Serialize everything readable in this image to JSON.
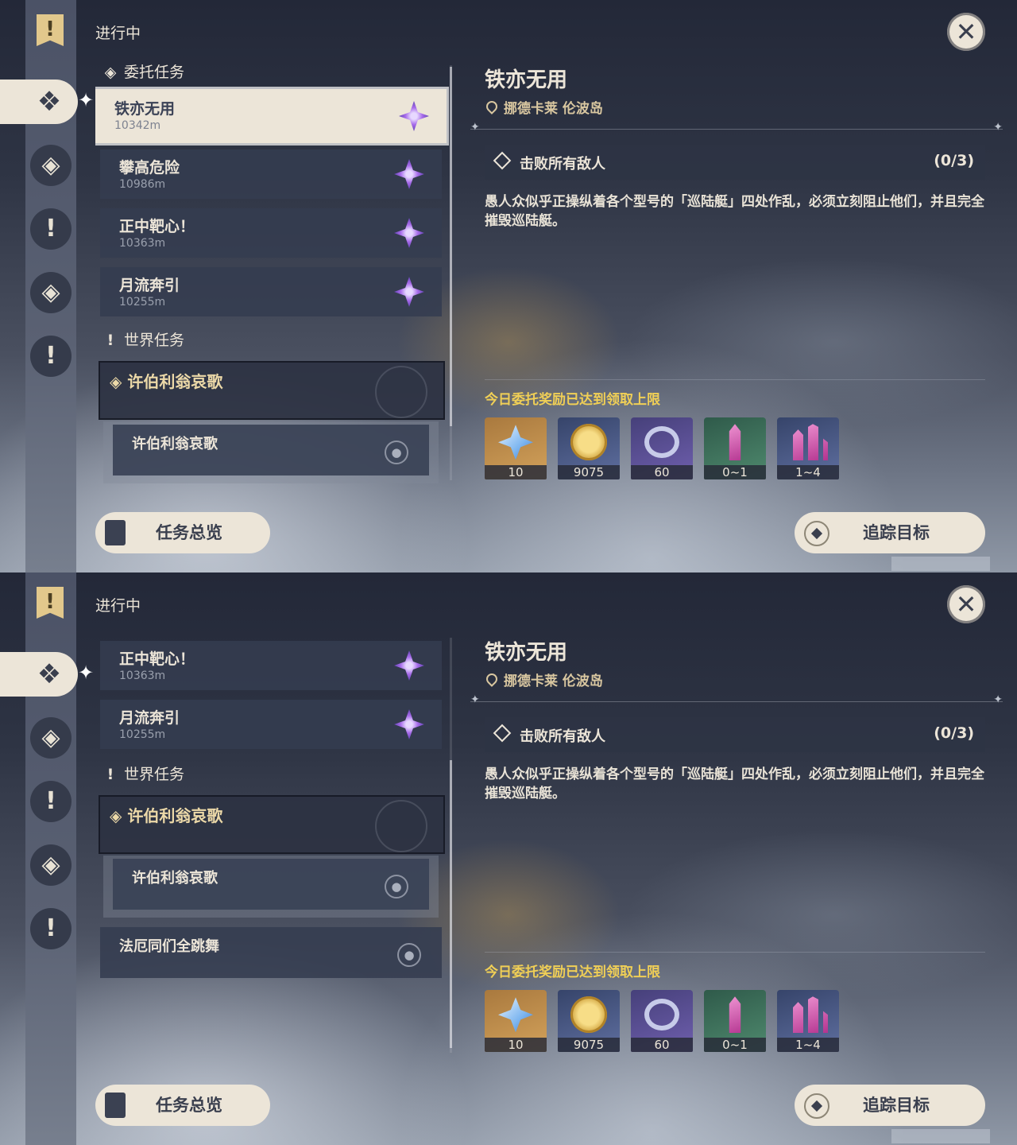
{
  "screens": [
    {
      "status_label": "进行中",
      "close_icon": "close-icon",
      "commission_section": "委托任务",
      "world_section": "世界任务",
      "commissions": [
        {
          "name": "铁亦无用",
          "distance": "10342m",
          "selected": true
        },
        {
          "name": "攀高危险",
          "distance": "10986m"
        },
        {
          "name": "正中靶心！",
          "distance": "10363m"
        },
        {
          "name": "月流奔引",
          "distance": "10255m"
        }
      ],
      "world_quest": {
        "title": "许伯利翁哀歌",
        "step": "许伯利翁哀歌"
      },
      "detail": {
        "title": "铁亦无用",
        "location": "挪德卡莱 伦波岛",
        "objective": "击败所有敌人",
        "objective_progress": "(0/3)",
        "description": "愚人众似乎正操纵着各个型号的「巡陆艇」四处作乱，必须立刻阻止他们，并且完全摧毁巡陆艇。",
        "reward_notice": "今日委托奖励已达到领取上限",
        "rewards": [
          {
            "icon": "primogem-icon",
            "count": "10"
          },
          {
            "icon": "mora-icon",
            "count": "9075"
          },
          {
            "icon": "adventure-exp-icon",
            "count": "60"
          },
          {
            "icon": "crystal-icon",
            "count": "0~1"
          },
          {
            "icon": "crystal-cluster-icon",
            "count": "1~4"
          }
        ]
      },
      "buttons": {
        "overview": "任务总览",
        "track": "追踪目标"
      }
    },
    {
      "status_label": "进行中",
      "world_section": "世界任务",
      "commissions": [
        {
          "name": "正中靶心！",
          "distance": "10363m"
        },
        {
          "name": "月流奔引",
          "distance": "10255m"
        }
      ],
      "world_quest": {
        "title": "许伯利翁哀歌",
        "step": "许伯利翁哀歌"
      },
      "extra_quest": "法厄同们全跳舞",
      "detail": {
        "title": "铁亦无用",
        "location": "挪德卡莱 伦波岛",
        "objective": "击败所有敌人",
        "objective_progress": "(0/3)",
        "description": "愚人众似乎正操纵着各个型号的「巡陆艇」四处作乱，必须立刻阻止他们，并且完全摧毁巡陆艇。",
        "reward_notice": "今日委托奖励已达到领取上限",
        "rewards": [
          {
            "icon": "primogem-icon",
            "count": "10"
          },
          {
            "icon": "mora-icon",
            "count": "9075"
          },
          {
            "icon": "adventure-exp-icon",
            "count": "60"
          },
          {
            "icon": "crystal-icon",
            "count": "0~1"
          },
          {
            "icon": "crystal-cluster-icon",
            "count": "1~4"
          }
        ]
      },
      "buttons": {
        "overview": "任务总览",
        "track": "追踪目标"
      }
    }
  ]
}
